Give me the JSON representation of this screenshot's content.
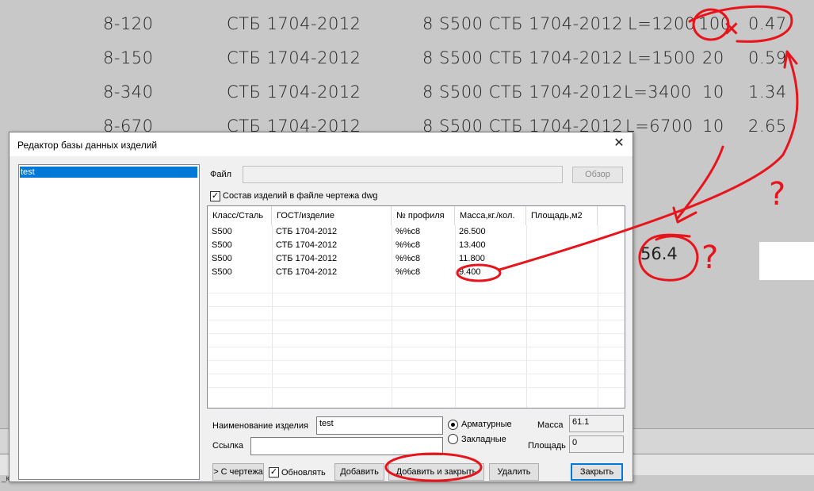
{
  "background": {
    "rows": [
      {
        "code": "8-120",
        "standard": "СТБ 1704-2012",
        "spec": "8 S500 СТБ 1704-2012",
        "length": "L=1200",
        "qty": "100",
        "mass": "0.47"
      },
      {
        "code": "8-150",
        "standard": "СТБ 1704-2012",
        "spec": "8 S500 СТБ 1704-2012",
        "length": "L=1500",
        "qty": "20",
        "mass": "0.59"
      },
      {
        "code": "8-340",
        "standard": "СТБ 1704-2012",
        "spec": "8 S500 СТБ 1704-2012",
        "length": "L=3400",
        "qty": "10",
        "mass": "1.34"
      },
      {
        "code": "8-670",
        "standard": "СТБ 1704-2012",
        "spec": "8 S500 СТБ 1704-2012",
        "length": "L=6700",
        "qty": "10",
        "mass": "2.65"
      }
    ],
    "total_mass": "56.4",
    "bottom_text": "_к"
  },
  "dialog": {
    "title": "Редактор базы данных изделий",
    "close_glyph": "✕",
    "tree_items": [
      "test"
    ],
    "file_label": "Файл",
    "file_value": "",
    "browse_label": "Обзор",
    "dwg_checkbox_label": "Состав изделий в файле чертежа dwg",
    "dwg_checked": "✓",
    "grid": {
      "columns": [
        "Класс/Сталь",
        "ГОСТ/изделие",
        "№ профиля",
        "Масса,кг./кол.",
        "Площадь,м2"
      ],
      "rows": [
        {
          "steel": "S500",
          "gost": "СТБ 1704-2012",
          "profile": "%%c8",
          "mass": "26.500",
          "area": ""
        },
        {
          "steel": "S500",
          "gost": "СТБ 1704-2012",
          "profile": "%%c8",
          "mass": "13.400",
          "area": ""
        },
        {
          "steel": "S500",
          "gost": "СТБ 1704-2012",
          "profile": "%%c8",
          "mass": "11.800",
          "area": ""
        },
        {
          "steel": "S500",
          "gost": "СТБ 1704-2012",
          "profile": "%%c8",
          "mass": "9.400",
          "area": ""
        }
      ]
    },
    "name_label": "Наименование изделия",
    "name_value": "test",
    "link_label": "Ссылка",
    "link_value": "",
    "radio_rebar": "Арматурные",
    "radio_embedded": "Закладные",
    "mass_label": "Масса",
    "mass_value": "61.1",
    "area_label": "Площадь",
    "area_value": "0",
    "from_drawing_button": "> С чертежа",
    "update_checkbox_label": "Обновлять",
    "update_checked": "✓",
    "add_button": "Добавить",
    "add_close_button": "Добавить и закрыть",
    "delete_button": "Удалить",
    "close_button": "Закрыть"
  },
  "annotations": {
    "color": "#e8141c",
    "multiply_mark": "×",
    "question_marks": [
      "?",
      "?"
    ]
  }
}
